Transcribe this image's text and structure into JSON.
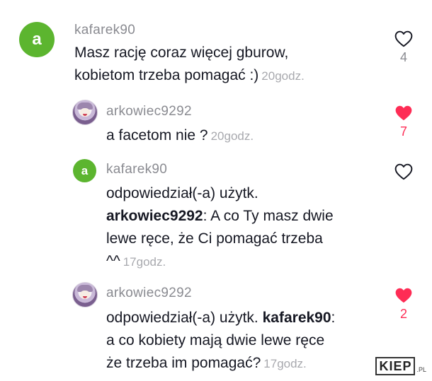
{
  "comments": [
    {
      "avatar_letter": "a",
      "username": "kafarek90",
      "lines": [
        "Masz rację coraz więcej gburow,",
        "kobietom trzeba pomagać :)"
      ],
      "time": "20godz.",
      "likes": "4",
      "liked": false
    },
    {
      "username": "arkowiec9292",
      "lines": [
        "a facetom nie ?"
      ],
      "time": "20godz.",
      "likes": "7",
      "liked": true
    },
    {
      "avatar_letter": "a",
      "username": "kafarek90",
      "reply_prefix": "odpowiedział(-a) użytk.",
      "mention": "arkowiec9292",
      "lines": [
        ": A co Ty masz dwie",
        "lewe ręce, że Ci pomagać trzeba",
        "^^"
      ],
      "time": "17godz.",
      "likes": "",
      "liked": false
    },
    {
      "username": "arkowiec9292",
      "reply_prefix": "odpowiedział(-a) użytk.",
      "mention": "kafarek90",
      "lines": [
        ":",
        "a co kobiety mają dwie lewe ręce",
        "że trzeba im pomagać?"
      ],
      "time": "17godz.",
      "likes": "2",
      "liked": true
    }
  ],
  "watermark": {
    "main": "KIEP",
    "suffix": ".PL"
  },
  "colors": {
    "like_red": "#fe2c55",
    "avatar_green": "#5cb52f",
    "muted": "#8a8b91"
  },
  "icons": {
    "like": "heart-icon"
  }
}
